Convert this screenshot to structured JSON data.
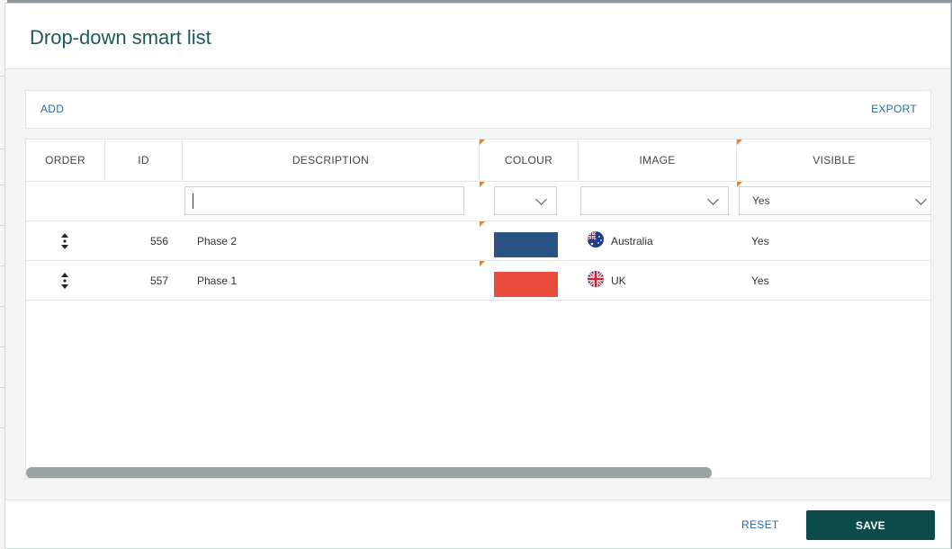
{
  "dialog": {
    "title": "Drop-down smart list"
  },
  "toolbar": {
    "add_label": "ADD",
    "export_label": "EXPORT"
  },
  "columns": {
    "order": "ORDER",
    "id": "ID",
    "description": "DESCRIPTION",
    "colour": "COLOUR",
    "image": "IMAGE",
    "visible": "VISIBLE"
  },
  "filters": {
    "description": "",
    "colour": "",
    "image": "",
    "visible": "Yes"
  },
  "rows": [
    {
      "id": "556",
      "description": "Phase 2",
      "colour": "#2a5485",
      "image": "Australia",
      "image_icon": "australia-flag-icon",
      "visible": "Yes"
    },
    {
      "id": "557",
      "description": "Phase 1",
      "colour": "#e84c3d",
      "image": "UK",
      "image_icon": "uk-flag-icon",
      "visible": "Yes"
    }
  ],
  "footer": {
    "reset_label": "RESET",
    "save_label": "SAVE"
  },
  "theme": {
    "accent": "#0d4a4a",
    "link": "#2a6aa0",
    "corner_marker": "#e8821e"
  }
}
